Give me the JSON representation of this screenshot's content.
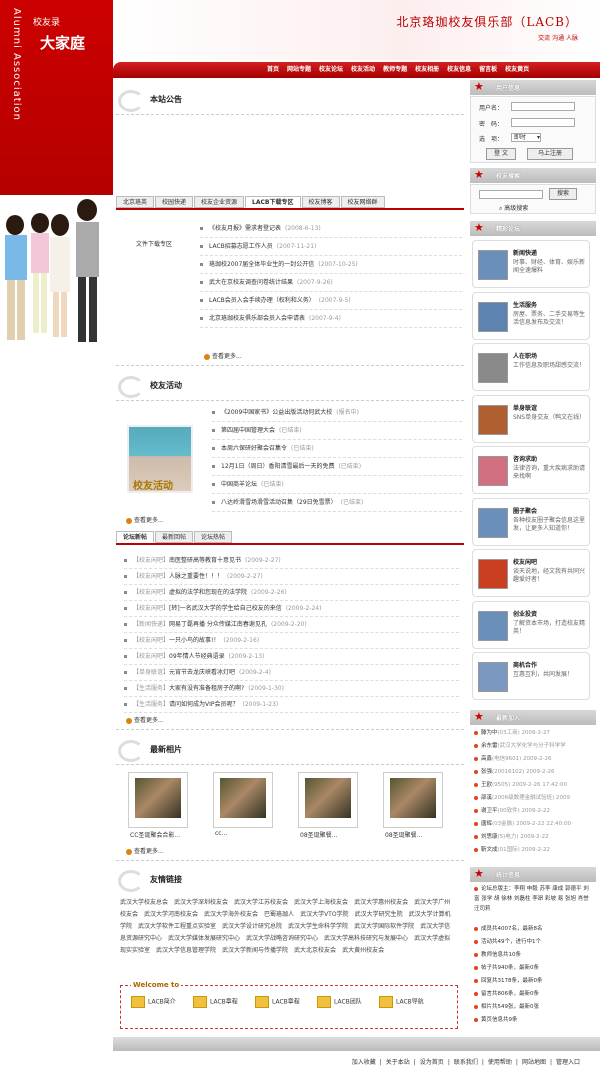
{
  "brand": {
    "logo_small": "校友录",
    "logo_big": "大家庭",
    "vertical": "Alumni Association",
    "title": "北京珞珈校友俱乐部（LACB）",
    "subtitle": "交流 沟通 人脉"
  },
  "nav": [
    "首页",
    "网站专题",
    "校友论坛",
    "校友活动",
    "教师专题",
    "校友相册",
    "校友信息",
    "留言板",
    "校友黄页"
  ],
  "notice": {
    "heading": "本站公告"
  },
  "tabs1": [
    "北京珞英",
    "校园快递",
    "校友企业资源",
    "LACB下载专区",
    "校友博客",
    "校友网络群"
  ],
  "download": {
    "label": "文件下载专区",
    "items": [
      {
        "t": "《校友月报》需求者登记表",
        "d": "(2008-6-13)"
      },
      {
        "t": "LACB招募志愿工作人员",
        "d": "(2007-11-21)"
      },
      {
        "t": "珞珈校2007届全体毕业生的一封公开信",
        "d": "(2007-10-25)"
      },
      {
        "t": "武大在京校友调查问卷统计结果",
        "d": "(2007-9-26)"
      },
      {
        "t": "LACB会员入会手续办理（权利和义务）",
        "d": "(2007-9-5)"
      },
      {
        "t": "北京珞珈校友俱乐部会员入会申请表",
        "d": "(2007-9-4)"
      }
    ],
    "more": "查看更多..."
  },
  "activity": {
    "heading": "校友活动",
    "photo_caption": "校友活动",
    "items": [
      {
        "t": "《2009中国家书》公益出版活动何武大校",
        "s": "(报名中)"
      },
      {
        "t": "第四届中国管理大会",
        "s": "(已结束)"
      },
      {
        "t": "本周六保研好聚会召集令",
        "s": "(已结束)"
      },
      {
        "t": "12月1日（周日）香阳清雪最后一天的免费",
        "s": "(已结束)"
      },
      {
        "t": "中国商羊论坛",
        "s": "(已结束)"
      },
      {
        "t": "八达岭滑雪场滑雪活动召集（29日免雪票）",
        "s": "(已结束)"
      }
    ],
    "more": "查看更多..."
  },
  "tabs2": [
    "论坛新帖",
    "最新回帖",
    "论坛热帖"
  ],
  "forum": {
    "items": [
      {
        "b": "【校友闲吧】",
        "t": "南医整研高等教育十意见书",
        "d": "(2009-2-27)"
      },
      {
        "b": "【校友闲吧】",
        "t": "人脉之重要性！！！",
        "d": "(2009-2-27)"
      },
      {
        "b": "【校友闲吧】",
        "t": "虚拟的法学和您现在的法学院",
        "d": "(2009-2-26)"
      },
      {
        "b": "【校友闲吧】",
        "t": "[转]一名武汉大学的学生给自己校友的来信",
        "d": "(2009-2-24)"
      },
      {
        "b": "【新闻快递】",
        "t": "网易丁磊再播 分众传媒江南春谢见孔",
        "d": "(2009-2-20)"
      },
      {
        "b": "【校友闲吧】",
        "t": "一只小鸟的故事!！",
        "d": "(2009-2-16)"
      },
      {
        "b": "【校友闲吧】",
        "t": "09年情人节经典语录",
        "d": "(2009-2-13)"
      },
      {
        "b": "【单身联谊】",
        "t": "元宵节去龙庆峡看冰灯吧",
        "d": "(2009-2-4)"
      },
      {
        "b": "【生活服务】",
        "t": "大家有没有准备租房子的啊?",
        "d": "(2009-1-30)"
      },
      {
        "b": "【生活服务】",
        "t": "请问如何成为VIP会员呢？",
        "d": "(2009-1-23)"
      }
    ],
    "more": "查看更多..."
  },
  "photos": {
    "heading": "最新相片",
    "items": [
      "CC圣诞聚会合影...",
      "cc...",
      "08圣诞聚餐...",
      "08圣诞聚餐..."
    ],
    "more": "查看更多..."
  },
  "links": {
    "heading": "友情链接",
    "items": [
      "武汉大学校友总会",
      "武汉大学深圳校友会",
      "武汉大学江苏校友会",
      "武汉大学上海校友会",
      "武汉大学惠州校友会",
      "武汉大学广州校友会",
      "武汉大学河南校友会",
      "武汉大学海外校友会",
      "巴蜀珞珈人",
      "武汉大学VTO学院",
      "武汉大学研究生院",
      "武汉大学计算机学院",
      "武汉大学软件工程重点实验室",
      "武汉大学设计研究总院",
      "武汉大学生命科学学院",
      "武汉大学国际软件学院",
      "武汉大学信息资源研究中心",
      "武汉大学媒体发展研究中心",
      "武汉大学战略咨询研究中心",
      "武汉大学高科技研究与发展中心",
      "武汉大学虚拟现实实验室",
      "武汉大学信息管理学院",
      "武汉大学新闻与传播学院",
      "武大北京校友会",
      "武大黄州校友会"
    ]
  },
  "welcome": {
    "title": "Welcome to",
    "items": [
      "LACB简介",
      "LACB章程",
      "LACB章程",
      "LACB团队",
      "LACB导航"
    ]
  },
  "footer": [
    "加入收藏",
    "关于本站",
    "设为首页",
    "联系我们",
    "使用帮助",
    "网站地图",
    "管理入口"
  ],
  "user": {
    "heading": "用户信息",
    "username_label": "用户名：",
    "password_label": "密　码：",
    "option_label": "选　项：",
    "option_value": "即时",
    "login": "登 文",
    "register": "马上注册"
  },
  "search": {
    "heading": "校友搜索",
    "button": "搜索",
    "advanced": "高级搜索"
  },
  "forum_side": {
    "heading": "精彩论坛",
    "items": [
      {
        "t": "新闻快递",
        "d": "时事、财经、体育、娱乐新闻全速爆料"
      },
      {
        "t": "生活服务",
        "d": "房屋、票务、二手交易等生活信息发布及交流！"
      },
      {
        "t": "人在职场",
        "d": "工作信息及职场甜感交流！"
      },
      {
        "t": "单身联谊",
        "d": "SNS单身交友（鸭文在线）"
      },
      {
        "t": "咨询求助",
        "d": "法律咨询，重大疾病求助请来找啊"
      },
      {
        "t": "圈子聚会",
        "d": "各种校友圈子聚会信息这里发，让更多人知道你！"
      },
      {
        "t": "校友闲吧",
        "d": "谈天说地，经文我有共同兴趣爱好者！"
      },
      {
        "t": "创业投资",
        "d": "了解资本市场，打造校友精英！"
      },
      {
        "t": "商机合作",
        "d": "互惠互利，共同发展！"
      }
    ]
  },
  "newjoin": {
    "heading": "最新加入",
    "items": [
      {
        "n": "滕为中",
        "e": "(03工商) 2009-2-27"
      },
      {
        "n": "余东雷",
        "e": "(武汉大学化学与分子科学学"
      },
      {
        "n": "高鑫",
        "e": "(电信9601) 2009-2-26"
      },
      {
        "n": "张强",
        "e": "(20016102) 2009-2-26"
      },
      {
        "n": "王欧",
        "e": "(9505) 2009-2-26 17:42:00"
      },
      {
        "n": "邵溪",
        "e": "(2006级数理金融试验班) 2009"
      },
      {
        "n": "谢卫平",
        "e": "(00软件) 2009-2-22"
      },
      {
        "n": "唐辉",
        "e": "(03金融) 2009-2-22 22:40:00"
      },
      {
        "n": "刘思康",
        "e": "(5)电力) 2009-2-22"
      },
      {
        "n": "靳文成",
        "e": "(01国际) 2009-2-22"
      }
    ]
  },
  "stats": {
    "heading": "统计信息",
    "items": [
      "论坛总版主：李翔 申毅 苏李 康成 郭德平 刘富 张学 胡 徐林 刘磊柱 李昂 彩坡 易 张旭 肖誉 汪司莉",
      "成员共4007名，最新8名",
      "活动共49个，进行中1个",
      "教师信息共10条",
      "帖子共940条，最新0条",
      "回复共3178条，最新0条",
      "留言共806条，最新0条",
      "相片共549张，最新0张",
      "黄页信息共9条"
    ]
  }
}
